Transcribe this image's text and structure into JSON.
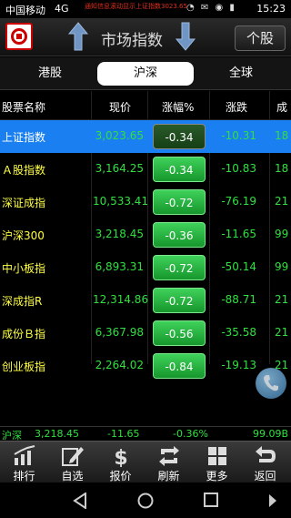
{
  "status_bar": {
    "carrier": "中国移动",
    "network": "4G",
    "ticker": "通知信息滚动显示上证指数3023.65",
    "icons": "◔ ✉ ◉ ▮",
    "clock": "15:23"
  },
  "header": {
    "title": "市场指数",
    "stock_button": "个股"
  },
  "tabs": [
    {
      "label": "港股"
    },
    {
      "label": "沪深",
      "selected": true
    },
    {
      "label": "全球"
    }
  ],
  "table": {
    "columns": [
      "股票名称",
      "现价",
      "涨幅%",
      "涨跌",
      "成"
    ],
    "rows": [
      {
        "name": "上证指数",
        "price": "3,023.65",
        "pct": "-0.34",
        "chg": "-10.31",
        "vol": "18",
        "selected": true
      },
      {
        "name": "Ａ股指数",
        "price": "3,164.25",
        "pct": "-0.34",
        "chg": "-10.83",
        "vol": "18"
      },
      {
        "name": "深证成指",
        "price": "10,533.41",
        "pct": "-0.72",
        "chg": "-76.19",
        "vol": "21"
      },
      {
        "name": "沪深300",
        "price": "3,218.45",
        "pct": "-0.36",
        "chg": "-11.65",
        "vol": "99"
      },
      {
        "name": "中小板指",
        "price": "6,893.31",
        "pct": "-0.72",
        "chg": "-50.14",
        "vol": "99"
      },
      {
        "name": "深成指R",
        "price": "12,314.86",
        "pct": "-0.72",
        "chg": "-88.71",
        "vol": "21"
      },
      {
        "name": "成份Ｂ指",
        "price": "6,367.98",
        "pct": "-0.56",
        "chg": "-35.58",
        "vol": "21"
      },
      {
        "name": "创业板指",
        "price": "2,264.02",
        "pct": "-0.84",
        "chg": "-19.13",
        "vol": "21"
      }
    ]
  },
  "ticker_strip": {
    "name": "沪深",
    "price": "3,218.45",
    "chg": "-11.65",
    "pct": "-0.36%",
    "vol": "99.09B"
  },
  "bottom_nav": [
    {
      "label": "排行",
      "icon": "ranking-chart-icon"
    },
    {
      "label": "自选",
      "icon": "edit-pen-icon"
    },
    {
      "label": "报价",
      "icon": "dollar-icon"
    },
    {
      "label": "刷新",
      "icon": "refresh-icon"
    },
    {
      "label": "更多",
      "icon": "grid-more-icon"
    },
    {
      "label": "返回",
      "icon": "back-arrow-icon"
    }
  ],
  "colors": {
    "down_green": "#30e040",
    "name_yellow": "#ffff40",
    "selected_row": "#1a7ff0"
  }
}
